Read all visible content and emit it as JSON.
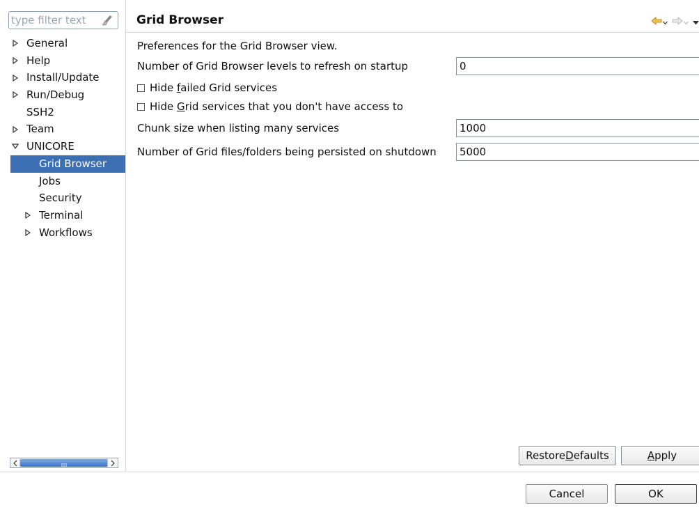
{
  "filter": {
    "placeholder": "type filter text"
  },
  "tree": [
    {
      "label": "General",
      "level": 0,
      "expandable": true,
      "expanded": false
    },
    {
      "label": "Help",
      "level": 0,
      "expandable": true,
      "expanded": false
    },
    {
      "label": "Install/Update",
      "level": 0,
      "expandable": true,
      "expanded": false
    },
    {
      "label": "Run/Debug",
      "level": 0,
      "expandable": true,
      "expanded": false
    },
    {
      "label": "SSH2",
      "level": 0,
      "expandable": false,
      "expanded": false
    },
    {
      "label": "Team",
      "level": 0,
      "expandable": true,
      "expanded": false
    },
    {
      "label": "UNICORE",
      "level": 0,
      "expandable": true,
      "expanded": true
    },
    {
      "label": "Grid Browser",
      "level": 1,
      "expandable": false,
      "expanded": false,
      "selected": true
    },
    {
      "label": "Jobs",
      "level": 1,
      "expandable": false,
      "expanded": false
    },
    {
      "label": "Security",
      "level": 1,
      "expandable": false,
      "expanded": false
    },
    {
      "label": "Terminal",
      "level": 1,
      "expandable": true,
      "expanded": false
    },
    {
      "label": "Workflows",
      "level": 1,
      "expandable": true,
      "expanded": false
    }
  ],
  "page": {
    "title": "Grid Browser",
    "description": "Preferences for the Grid Browser view.",
    "refresh_levels": {
      "label": "Number of Grid Browser levels to refresh on startup",
      "value": "0"
    },
    "hide_failed": {
      "pre": "Hide ",
      "mnemonic": "f",
      "post": "ailed Grid services",
      "checked": false
    },
    "hide_noaccess": {
      "pre": "Hide ",
      "mnemonic": "G",
      "post": "rid services that you don't have access to",
      "checked": false
    },
    "chunk_size": {
      "label": "Chunk size when listing many services",
      "value": "1000"
    },
    "persisted": {
      "label": "Number of Grid files/folders being persisted on shutdown",
      "value": "5000"
    }
  },
  "buttons": {
    "restore": {
      "pre": "Restore ",
      "mnemonic": "D",
      "post": "efaults"
    },
    "apply": {
      "pre": "",
      "mnemonic": "A",
      "post": "pply"
    },
    "cancel": "Cancel",
    "ok": "OK"
  },
  "colors": {
    "selection": "#3c6eb4",
    "nav_back": "#e8a33a"
  }
}
